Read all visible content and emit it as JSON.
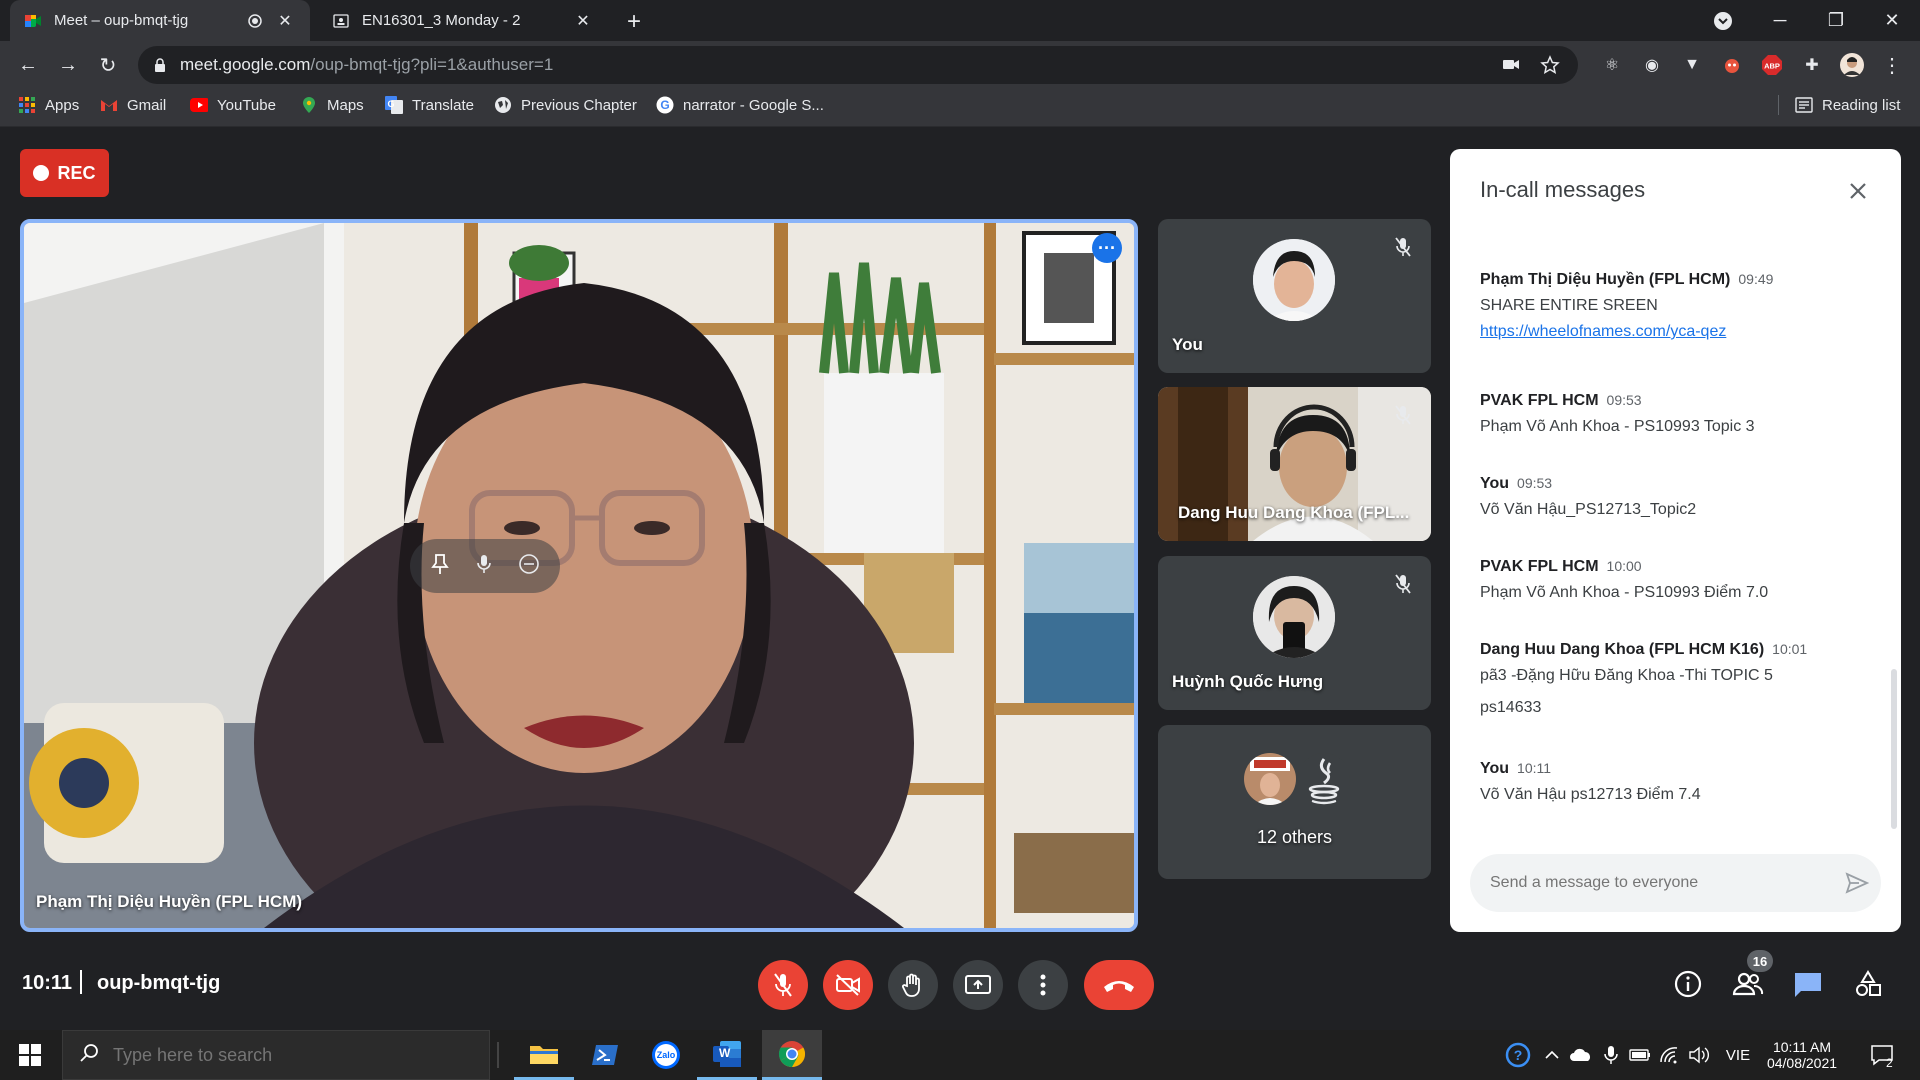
{
  "browser": {
    "tabs": [
      {
        "title": "Meet – oup-bmqt-tjg",
        "icon": "google-meet-icon",
        "active": true
      },
      {
        "title": "EN16301_3 Monday - 2",
        "icon": "contact-card-icon",
        "active": false
      }
    ],
    "new_tab_label": "+",
    "address": {
      "host": "meet.google.com",
      "path": "/oup-bmqt-tjg?pli=1&authuser=1"
    },
    "bookmarks": [
      {
        "label": "Apps",
        "icon": "apps-grid-icon"
      },
      {
        "label": "Gmail",
        "icon": "gmail-icon"
      },
      {
        "label": "YouTube",
        "icon": "youtube-icon"
      },
      {
        "label": "Maps",
        "icon": "maps-pin-icon"
      },
      {
        "label": "Translate",
        "icon": "translate-icon"
      },
      {
        "label": "Previous Chapter",
        "icon": "globe-icon"
      },
      {
        "label": "narrator - Google S...",
        "icon": "google-icon"
      }
    ],
    "reading_list_label": "Reading list",
    "colors": {
      "frame": "#202124",
      "toolbar": "#35363a"
    }
  },
  "meet": {
    "rec_label": "REC",
    "main_speaker": {
      "name": "Phạm Thị Diệu Huyền (FPL HCM)"
    },
    "tiles": [
      {
        "name": "You",
        "muted": true,
        "kind": "avatar"
      },
      {
        "name": "Dang Huu Dang Khoa (FPL...",
        "muted": true,
        "kind": "video"
      },
      {
        "name": "Huỳnh Quốc Hưng",
        "muted": true,
        "kind": "avatar"
      },
      {
        "name": "12 others",
        "muted": false,
        "kind": "others"
      }
    ],
    "meeting_time": "10:11",
    "meeting_code": "oup-bmqt-tjg",
    "people_count": "16",
    "colors": {
      "accent": "#8ab4f8",
      "danger": "#ea4335",
      "tile": "#3c4043",
      "bg": "#202124"
    }
  },
  "chat": {
    "title": "In-call messages",
    "messages": [
      {
        "sender": "Phạm Thị Diệu Huyền (FPL HCM)",
        "time": "09:49",
        "lines": [
          "SHARE  ENTIRE SREEN"
        ],
        "link": "https://wheelofnames.com/yca-qez"
      },
      {
        "sender": "PVAK FPL HCM",
        "time": "09:53",
        "lines": [
          "Phạm Võ Anh Khoa - PS10993 Topic 3"
        ]
      },
      {
        "sender": "You",
        "time": "09:53",
        "lines": [
          "Võ Văn Hậu_PS12713_Topic2"
        ]
      },
      {
        "sender": "PVAK FPL HCM",
        "time": "10:00",
        "lines": [
          "Phạm Võ Anh Khoa - PS10993 Điểm 7.0"
        ]
      },
      {
        "sender": "Dang Huu Dang Khoa (FPL HCM K16)",
        "time": "10:01",
        "lines": [
          "pã3 -Đặng Hữu Đăng Khoa -Thi TOPIC 5",
          "ps14633"
        ]
      },
      {
        "sender": "You",
        "time": "10:11",
        "lines": [
          "Võ Văn Hậu ps12713 Điểm 7.4"
        ]
      }
    ],
    "input_placeholder": "Send a message to everyone"
  },
  "taskbar": {
    "search_placeholder": "Type here to search",
    "apps": [
      "file-explorer-icon",
      "powershell-icon",
      "zalo-icon",
      "word-icon",
      "chrome-icon"
    ],
    "zalo_label": "Zalo",
    "word_label": "W",
    "lang": "VIE",
    "time": "10:11 AM",
    "date": "04/08/2021",
    "notification_count": "2"
  }
}
